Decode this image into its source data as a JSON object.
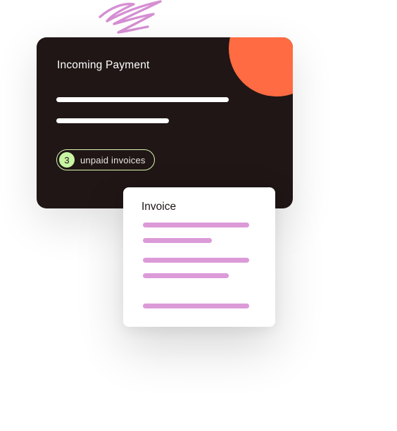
{
  "payment_card": {
    "title": "Incoming Payment",
    "unpaid_count": "3",
    "unpaid_label": "unpaid invoices"
  },
  "invoice_card": {
    "title": "Invoice"
  },
  "colors": {
    "card_background": "#201616",
    "accent_orange": "#ff6b42",
    "badge_green": "#c8f5a2",
    "invoice_line_pink": "#dc9ad8",
    "squiggle_purple": "#d68fd3"
  }
}
